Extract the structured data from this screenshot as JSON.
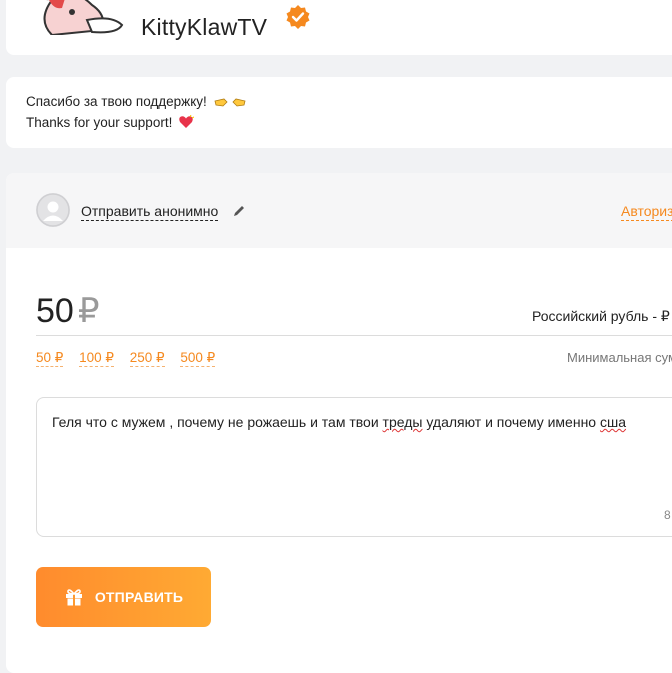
{
  "header": {
    "streamer_name": "KittyKlawTV",
    "verified_icon": "verified-badge-icon",
    "avatar_icon": "cat-mascot-avatar"
  },
  "thanks": {
    "line_ru": "Спасибо за твою поддержку!",
    "line_en": "Thanks for your support!"
  },
  "sender": {
    "anonymous_label": "Отправить анонимно",
    "login_label": "Авториз"
  },
  "amount": {
    "value": "50",
    "currency_symbol": "₽",
    "currency_name": "Российский рубль - ₽",
    "presets": [
      "50 ₽",
      "100 ₽",
      "250 ₽",
      "500 ₽"
    ],
    "min_sum_label": "Минимальная сум"
  },
  "message": {
    "text_before": "Геля что с мужем , почему не рожаешь и там твои ",
    "text_misspelled_1": "треды",
    "text_middle": " удаляют и почему именно ",
    "text_misspelled_2": "сша",
    "char_count": "8"
  },
  "send_button": {
    "label": "ОТПРАВИТЬ"
  },
  "colors": {
    "accent": "#f5891f",
    "button_start": "#ff8b2d",
    "button_end": "#ffaa33",
    "verified": "#f5891f"
  }
}
